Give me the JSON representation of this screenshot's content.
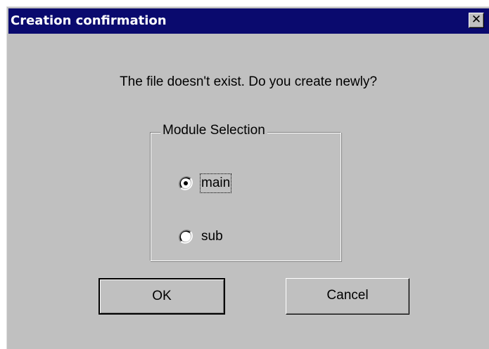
{
  "window": {
    "title": "Creation confirmation",
    "close_glyph": "✕",
    "close_icon": "close-icon"
  },
  "message": "The file doesn't exist. Do you create newly?",
  "module_selection": {
    "legend": "Module Selection",
    "options": [
      {
        "label": "main",
        "selected": true,
        "focused": true
      },
      {
        "label": "sub",
        "selected": false,
        "focused": false
      }
    ]
  },
  "buttons": {
    "ok_label": "OK",
    "cancel_label": "Cancel"
  },
  "colors": {
    "titlebar": "#0a0a6e",
    "dialog_face": "#c0c0c0",
    "title_text": "#ffffff"
  }
}
